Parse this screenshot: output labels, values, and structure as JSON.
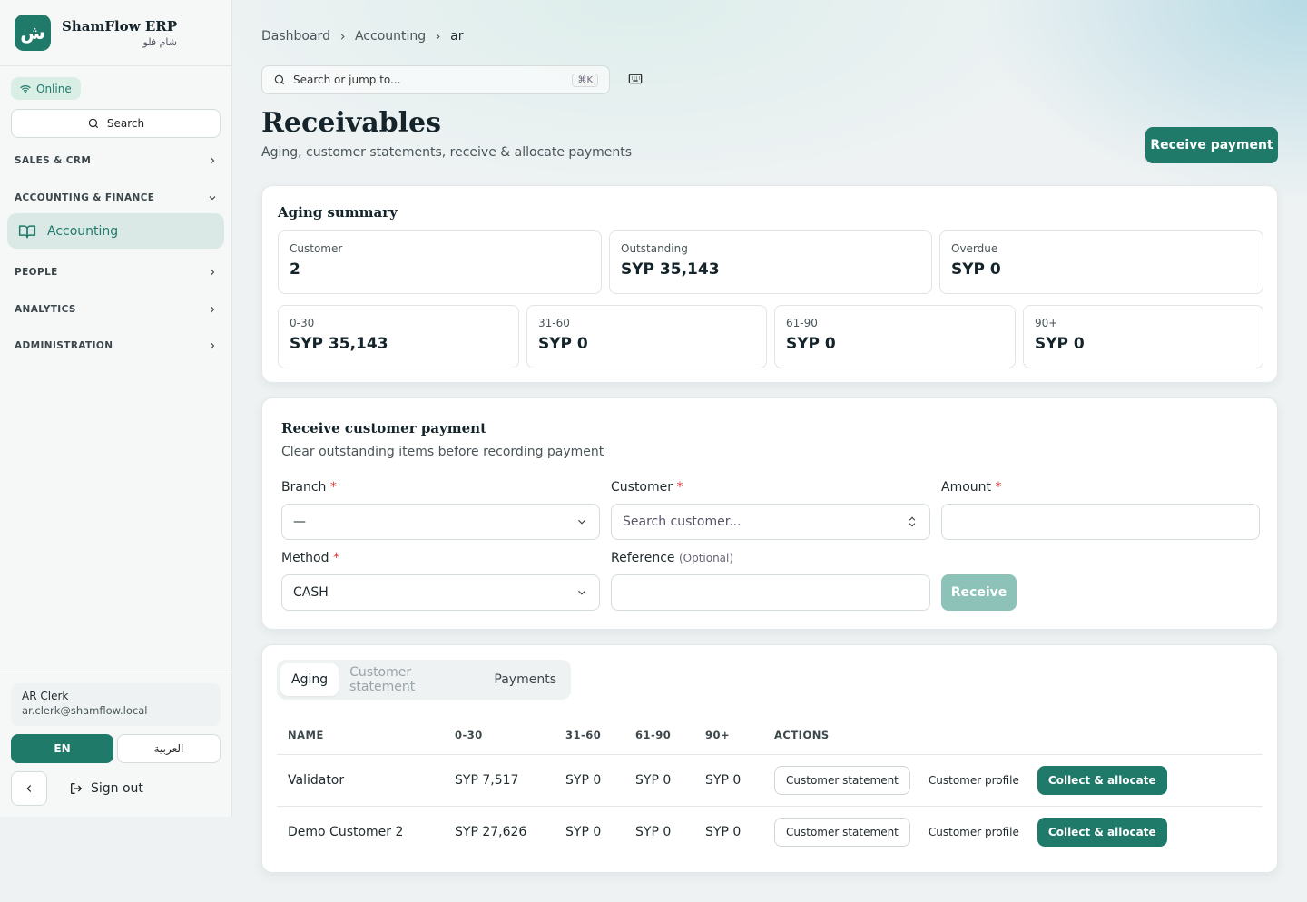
{
  "brand": {
    "logo_glyph": "ش",
    "name": "ShamFlow ERP",
    "subtitle": "شام فلو"
  },
  "sidebar": {
    "status": "Online",
    "search_label": "Search",
    "sections": [
      {
        "label": "SALES & CRM"
      },
      {
        "label": "ACCOUNTING & FINANCE"
      },
      {
        "label": "PEOPLE"
      },
      {
        "label": "ANALYTICS"
      },
      {
        "label": "ADMINISTRATION"
      }
    ],
    "active_item": "Accounting",
    "user": {
      "name": "AR Clerk",
      "email": "ar.clerk@shamflow.local"
    },
    "lang_en": "EN",
    "lang_ar": "العربية",
    "sign_out": "Sign out"
  },
  "breadcrumb": [
    "Dashboard",
    "Accounting",
    "ar"
  ],
  "top_search": {
    "placeholder": "Search or jump to...",
    "shortcut": "⌘K"
  },
  "page": {
    "title": "Receivables",
    "subtitle": "Aging, customer statements, receive & allocate payments",
    "primary_action": "Receive payment"
  },
  "aging_summary": {
    "title": "Aging summary",
    "top": [
      {
        "label": "Customer",
        "value": "2"
      },
      {
        "label": "Outstanding",
        "value": "SYP 35,143"
      },
      {
        "label": "Overdue",
        "value": "SYP 0"
      }
    ],
    "buckets": [
      {
        "label": "0-30",
        "value": "SYP 35,143"
      },
      {
        "label": "31-60",
        "value": "SYP 0"
      },
      {
        "label": "61-90",
        "value": "SYP 0"
      },
      {
        "label": "90+",
        "value": "SYP 0"
      }
    ]
  },
  "payment_form": {
    "title": "Receive customer payment",
    "subtitle": "Clear outstanding items before recording payment",
    "branch_label": "Branch",
    "branch_value": "—",
    "customer_label": "Customer",
    "customer_placeholder": "Search customer...",
    "amount_label": "Amount",
    "amount_value": "",
    "method_label": "Method",
    "method_value": "CASH",
    "reference_label": "Reference",
    "reference_optional": "(Optional)",
    "reference_value": "",
    "required_mark": "*",
    "submit_label": "Receive"
  },
  "tabs": [
    "Aging",
    "Customer statement",
    "Payments"
  ],
  "table": {
    "columns": [
      "NAME",
      "0-30",
      "31-60",
      "61-90",
      "90+",
      "ACTIONS"
    ],
    "rows": [
      {
        "name": "Validator",
        "b0_30": "SYP 7,517",
        "b31_60": "SYP 0",
        "b61_90": "SYP 0",
        "b90": "SYP 0"
      },
      {
        "name": "Demo Customer 2",
        "b0_30": "SYP 27,626",
        "b31_60": "SYP 0",
        "b61_90": "SYP 0",
        "b90": "SYP 0"
      }
    ],
    "actions": {
      "statement": "Customer statement",
      "profile": "Customer profile",
      "collect": "Collect & allocate"
    }
  },
  "colors": {
    "accent": "#1f7a6a",
    "accent_disabled": "#8cc2b8",
    "required": "#d33333"
  }
}
